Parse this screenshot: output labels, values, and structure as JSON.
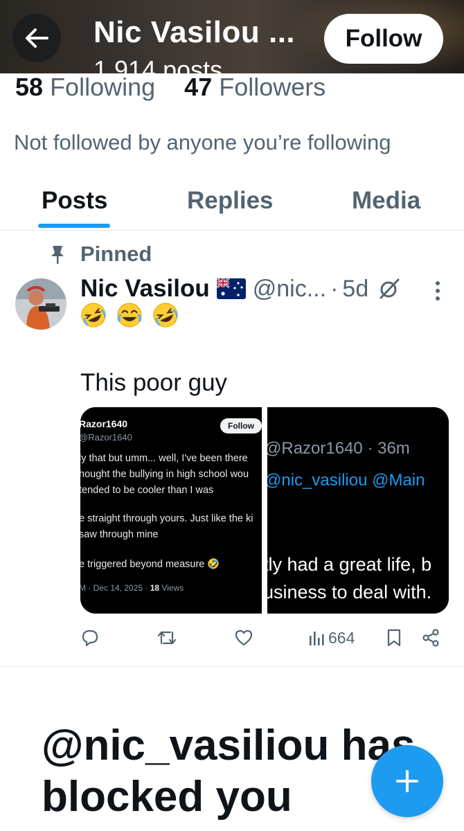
{
  "header": {
    "title": "Nic Vasilou ...",
    "posts_count": "1,914 posts",
    "follow_label": "Follow"
  },
  "stats": {
    "following_count": "58",
    "following_label": "Following",
    "followers_count": "47",
    "followers_label": "Followers"
  },
  "not_followed_text": "Not followed by anyone you’re following",
  "tabs": [
    {
      "label": "Posts",
      "active": true
    },
    {
      "label": "Replies",
      "active": false
    },
    {
      "label": "Media",
      "active": false
    }
  ],
  "post": {
    "pinned_label": "Pinned",
    "author_name": "Nic Vasilou",
    "flag": "australian-flag",
    "handle": "@nic...",
    "separator": "·",
    "age": "5d",
    "emojis": [
      "rolling-on-floor-laughing",
      "face-with-tears-of-joy",
      "rolling-on-floor-laughing"
    ],
    "text": "This poor guy",
    "media": {
      "left": {
        "username": "Razor1640",
        "handle": "@Razor1640",
        "follow_label": "Follow",
        "lines": [
          "ly that but umm... well, I've been there",
          "hought the bullying in high school wou",
          "tended to be cooler than I was",
          "e straight through yours. Just like the ki",
          " saw through mine",
          "e triggered beyond measure 🤣"
        ],
        "meta_prefix": "M · Dec 14, 2025 · ",
        "views_count": "18",
        "views_label": " Views"
      },
      "right": {
        "handle_time": "@Razor1640 · 36m",
        "mentions": "@nic_vasiliou @Main",
        "lines": [
          "tly had a great life, b",
          "usiness to deal with."
        ]
      }
    },
    "views": "664"
  },
  "blocked_message": "@nic_vasiliou has blocked you",
  "colors": {
    "accent": "#1d9bf0",
    "text_primary": "#0f1419",
    "text_secondary": "#536471"
  }
}
